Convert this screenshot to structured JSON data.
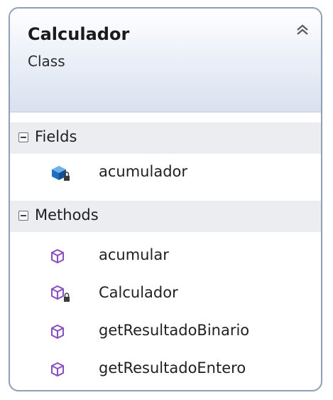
{
  "class": {
    "name": "Calculador",
    "kind": "Class"
  },
  "fields": {
    "title": "Fields",
    "items": [
      {
        "label": "acumulador",
        "icon": "private-field-icon"
      }
    ]
  },
  "methods": {
    "title": "Methods",
    "items": [
      {
        "label": "acumular",
        "icon": "method-icon"
      },
      {
        "label": "Calculador",
        "icon": "private-method-icon"
      },
      {
        "label": "getResultadoBinario",
        "icon": "method-icon"
      },
      {
        "label": "getResultadoEntero",
        "icon": "method-icon"
      }
    ]
  },
  "colors": {
    "border": "#8f9fb5",
    "header_gradient_end": "#d9e1ee",
    "section_bg": "#ebedf1",
    "method_icon": "#8a4fbf",
    "field_icon": "#1f6fc0"
  }
}
